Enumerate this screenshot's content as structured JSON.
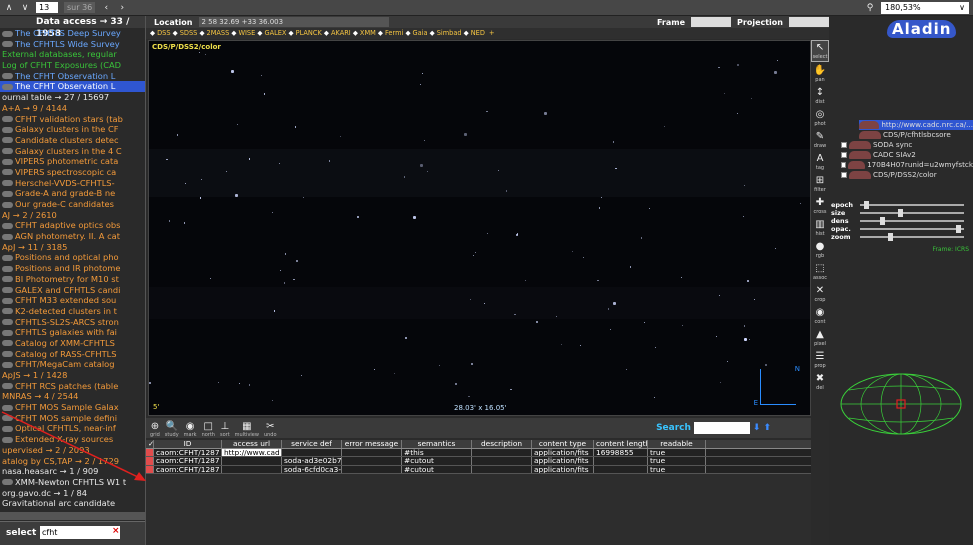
{
  "pdf_toolbar": {
    "page_current": "13",
    "page_of": "sur 36",
    "zoom": "180,53%"
  },
  "left_panel": {
    "header": "Data access → 33 / 1958",
    "rows": [
      {
        "t": "The CFHTLS Deep Survey",
        "c": "bl",
        "ic": true
      },
      {
        "t": "The CFHTLS Wide Survey",
        "c": "bl",
        "ic": true
      },
      {
        "t": "External databases, regular",
        "c": "gr",
        "ic": false
      },
      {
        "t": "Log of CFHT Exposures (CAD",
        "c": "gr",
        "ic": false
      },
      {
        "t": "The CFHT Observation L",
        "c": "bl",
        "ic": true
      },
      {
        "t": "The CFHT Observation L",
        "c": "wh",
        "ic": true,
        "sel": true
      },
      {
        "t": "ournal table → 27 / 15697",
        "c": "wh",
        "ic": false
      },
      {
        "t": "A+A → 9 / 4144",
        "c": "or",
        "ic": false
      },
      {
        "t": "CFHT validation stars (tab",
        "c": "or",
        "ic": true
      },
      {
        "t": "Galaxy clusters in the CF",
        "c": "or",
        "ic": true
      },
      {
        "t": "Candidate clusters detec",
        "c": "or",
        "ic": true
      },
      {
        "t": "Galaxy clusters in the 4 C",
        "c": "or",
        "ic": true
      },
      {
        "t": "VIPERS photometric cata",
        "c": "or",
        "ic": true
      },
      {
        "t": "VIPERS spectroscopic ca",
        "c": "or",
        "ic": true
      },
      {
        "t": "Herschel-VVDS-CFHTLS-",
        "c": "or",
        "ic": true
      },
      {
        "t": "Grade-A and grade-B ne",
        "c": "or",
        "ic": true
      },
      {
        "t": "Our grade-C candidates",
        "c": "or",
        "ic": true
      },
      {
        "t": "AJ → 2 / 2610",
        "c": "or",
        "ic": false
      },
      {
        "t": "CFHT adaptive optics obs",
        "c": "or",
        "ic": true
      },
      {
        "t": "AGN photometry. II. A cat",
        "c": "or",
        "ic": true
      },
      {
        "t": "ApJ → 11 / 3185",
        "c": "or",
        "ic": false
      },
      {
        "t": "Positions and optical pho",
        "c": "or",
        "ic": true
      },
      {
        "t": "Positions and IR photome",
        "c": "or",
        "ic": true
      },
      {
        "t": "BI Photometry for M10 st",
        "c": "or",
        "ic": true
      },
      {
        "t": "GALEX and CFHTLS candi",
        "c": "or",
        "ic": true
      },
      {
        "t": "CFHT M33 extended sou",
        "c": "or",
        "ic": true
      },
      {
        "t": "K2-detected clusters in t",
        "c": "or",
        "ic": true
      },
      {
        "t": "CFHTLS-SL2S-ARCS stron",
        "c": "or",
        "ic": true
      },
      {
        "t": "CFHTLS galaxies with fai",
        "c": "or",
        "ic": true
      },
      {
        "t": "Catalog of XMM-CFHTLS",
        "c": "or",
        "ic": true
      },
      {
        "t": "Catalog of RASS-CFHTLS",
        "c": "or",
        "ic": true
      },
      {
        "t": "CFHT/MegaCam catalog",
        "c": "or",
        "ic": true
      },
      {
        "t": "ApJS → 1 / 1428",
        "c": "or",
        "ic": false
      },
      {
        "t": "CFHT RCS patches (table",
        "c": "or",
        "ic": true
      },
      {
        "t": "MNRAS → 4 / 2544",
        "c": "or",
        "ic": false
      },
      {
        "t": "CFHT MOS Sample Galax",
        "c": "or",
        "ic": true
      },
      {
        "t": "CFHT MOS sample defini",
        "c": "or",
        "ic": true
      },
      {
        "t": "Optical CFHTLS, near-inf",
        "c": "or",
        "ic": true
      },
      {
        "t": "Extended X-ray sources",
        "c": "or",
        "ic": true
      },
      {
        "t": "upervised → 2 / 2093",
        "c": "or",
        "ic": false
      },
      {
        "t": "atalog by CS,TAP → 2 / 1729",
        "c": "or",
        "ic": false
      },
      {
        "t": "nasa.heasarc → 1 / 909",
        "c": "wh",
        "ic": false
      },
      {
        "t": "XMM-Newton CFHTLS W1 t",
        "c": "wh",
        "ic": true
      },
      {
        "t": "org.gavo.dc → 1 / 84",
        "c": "wh",
        "ic": false
      },
      {
        "t": "Gravitational arc candidate",
        "c": "wh",
        "ic": false
      }
    ],
    "select_label": "select",
    "select_value": "cfht"
  },
  "location": {
    "label": "Location",
    "value": "2 58 32.69 +33 36.003",
    "frame_label": "Frame",
    "projection_label": "Projection"
  },
  "surveys": {
    "items": [
      "DSS",
      "SDSS",
      "2MASS",
      "WISE",
      "GALEX",
      "PLANCK",
      "AKARI",
      "XMM",
      "Fermi",
      "Gaia",
      "Simbad",
      "NED"
    ],
    "add": "+"
  },
  "sky": {
    "survey_label": "CDS/P/DSS2/color",
    "fov": "28.03' x 16.05'",
    "scale": "5'",
    "north": "N",
    "east": "E"
  },
  "table_toolbar": {
    "tools": [
      {
        "g": "⊕",
        "l": "grid"
      },
      {
        "g": "🔍",
        "l": "study"
      },
      {
        "g": "◉",
        "l": "mark"
      },
      {
        "g": "□",
        "l": "north"
      },
      {
        "g": "⊥",
        "l": "sort"
      },
      {
        "g": "▦",
        "l": "multiview"
      },
      {
        "g": "✂",
        "l": "undo"
      }
    ],
    "search_label": "Search"
  },
  "table": {
    "headers": [
      "✓",
      "ID",
      "access url",
      "service def",
      "error message",
      "semantics",
      "description",
      "content type",
      "content length",
      "readable"
    ],
    "rows": [
      [
        "",
        "caom:CFHT/1287",
        "http://www.cad",
        "",
        "",
        "#this",
        "",
        "application/fits",
        "16998855",
        "true"
      ],
      [
        "",
        "caom:CFHT/1287",
        "",
        "soda-ad3e02b7",
        "",
        "#cutout",
        "",
        "application/fits",
        "",
        "true"
      ],
      [
        "",
        "caom:CFHT/1287",
        "",
        "soda-6cfd0ca3-7",
        "",
        "#cutout",
        "",
        "application/fits",
        "",
        "true"
      ]
    ]
  },
  "tools": [
    {
      "g": "↖",
      "l": "select",
      "on": true
    },
    {
      "g": "✋",
      "l": "pan"
    },
    {
      "g": "↕",
      "l": "dist"
    },
    {
      "g": "◎",
      "l": "phot"
    },
    {
      "g": "✎",
      "l": "draw"
    },
    {
      "g": "A",
      "l": "tag"
    },
    {
      "g": "⊞",
      "l": "filter"
    },
    {
      "g": "✚",
      "l": "cross"
    },
    {
      "g": "▥",
      "l": "hist"
    },
    {
      "g": "●",
      "l": "rgb"
    },
    {
      "g": "⬚",
      "l": "assoc"
    },
    {
      "g": "✕",
      "l": "crop"
    },
    {
      "g": "◉",
      "l": "cont"
    },
    {
      "g": "▲",
      "l": "pixel"
    },
    {
      "g": "☰",
      "l": "prop"
    },
    {
      "g": "✖",
      "l": "del"
    }
  ],
  "right_panel": {
    "frame_top": "Frame",
    "projection_top": "Projection",
    "logo": "Aladin",
    "layers": [
      {
        "t": "http://www.cadc.nrc.ca/...",
        "hl": true
      },
      {
        "t": "CDS/P/cfhtlsbcsore",
        "hl": false
      },
      {
        "t": "SODA sync",
        "hl": false
      },
      {
        "t": "CADC SIAv2",
        "hl": false
      },
      {
        "t": "170B4H07runid=u2wmyfstck",
        "hl": false
      },
      {
        "t": "CDS/P/DSS2/color",
        "hl": false
      }
    ],
    "sliders": [
      {
        "l": "epoch"
      },
      {
        "l": "size"
      },
      {
        "l": "dens"
      },
      {
        "l": "opac."
      },
      {
        "l": "zoom"
      }
    ],
    "frame_label": "Frame: ICRS"
  },
  "colors": {
    "accent": "#2f56d1",
    "orange": "#f39a3a",
    "green": "#39c43a",
    "blue": "#6aa8ff",
    "red": "#e14c4c"
  }
}
